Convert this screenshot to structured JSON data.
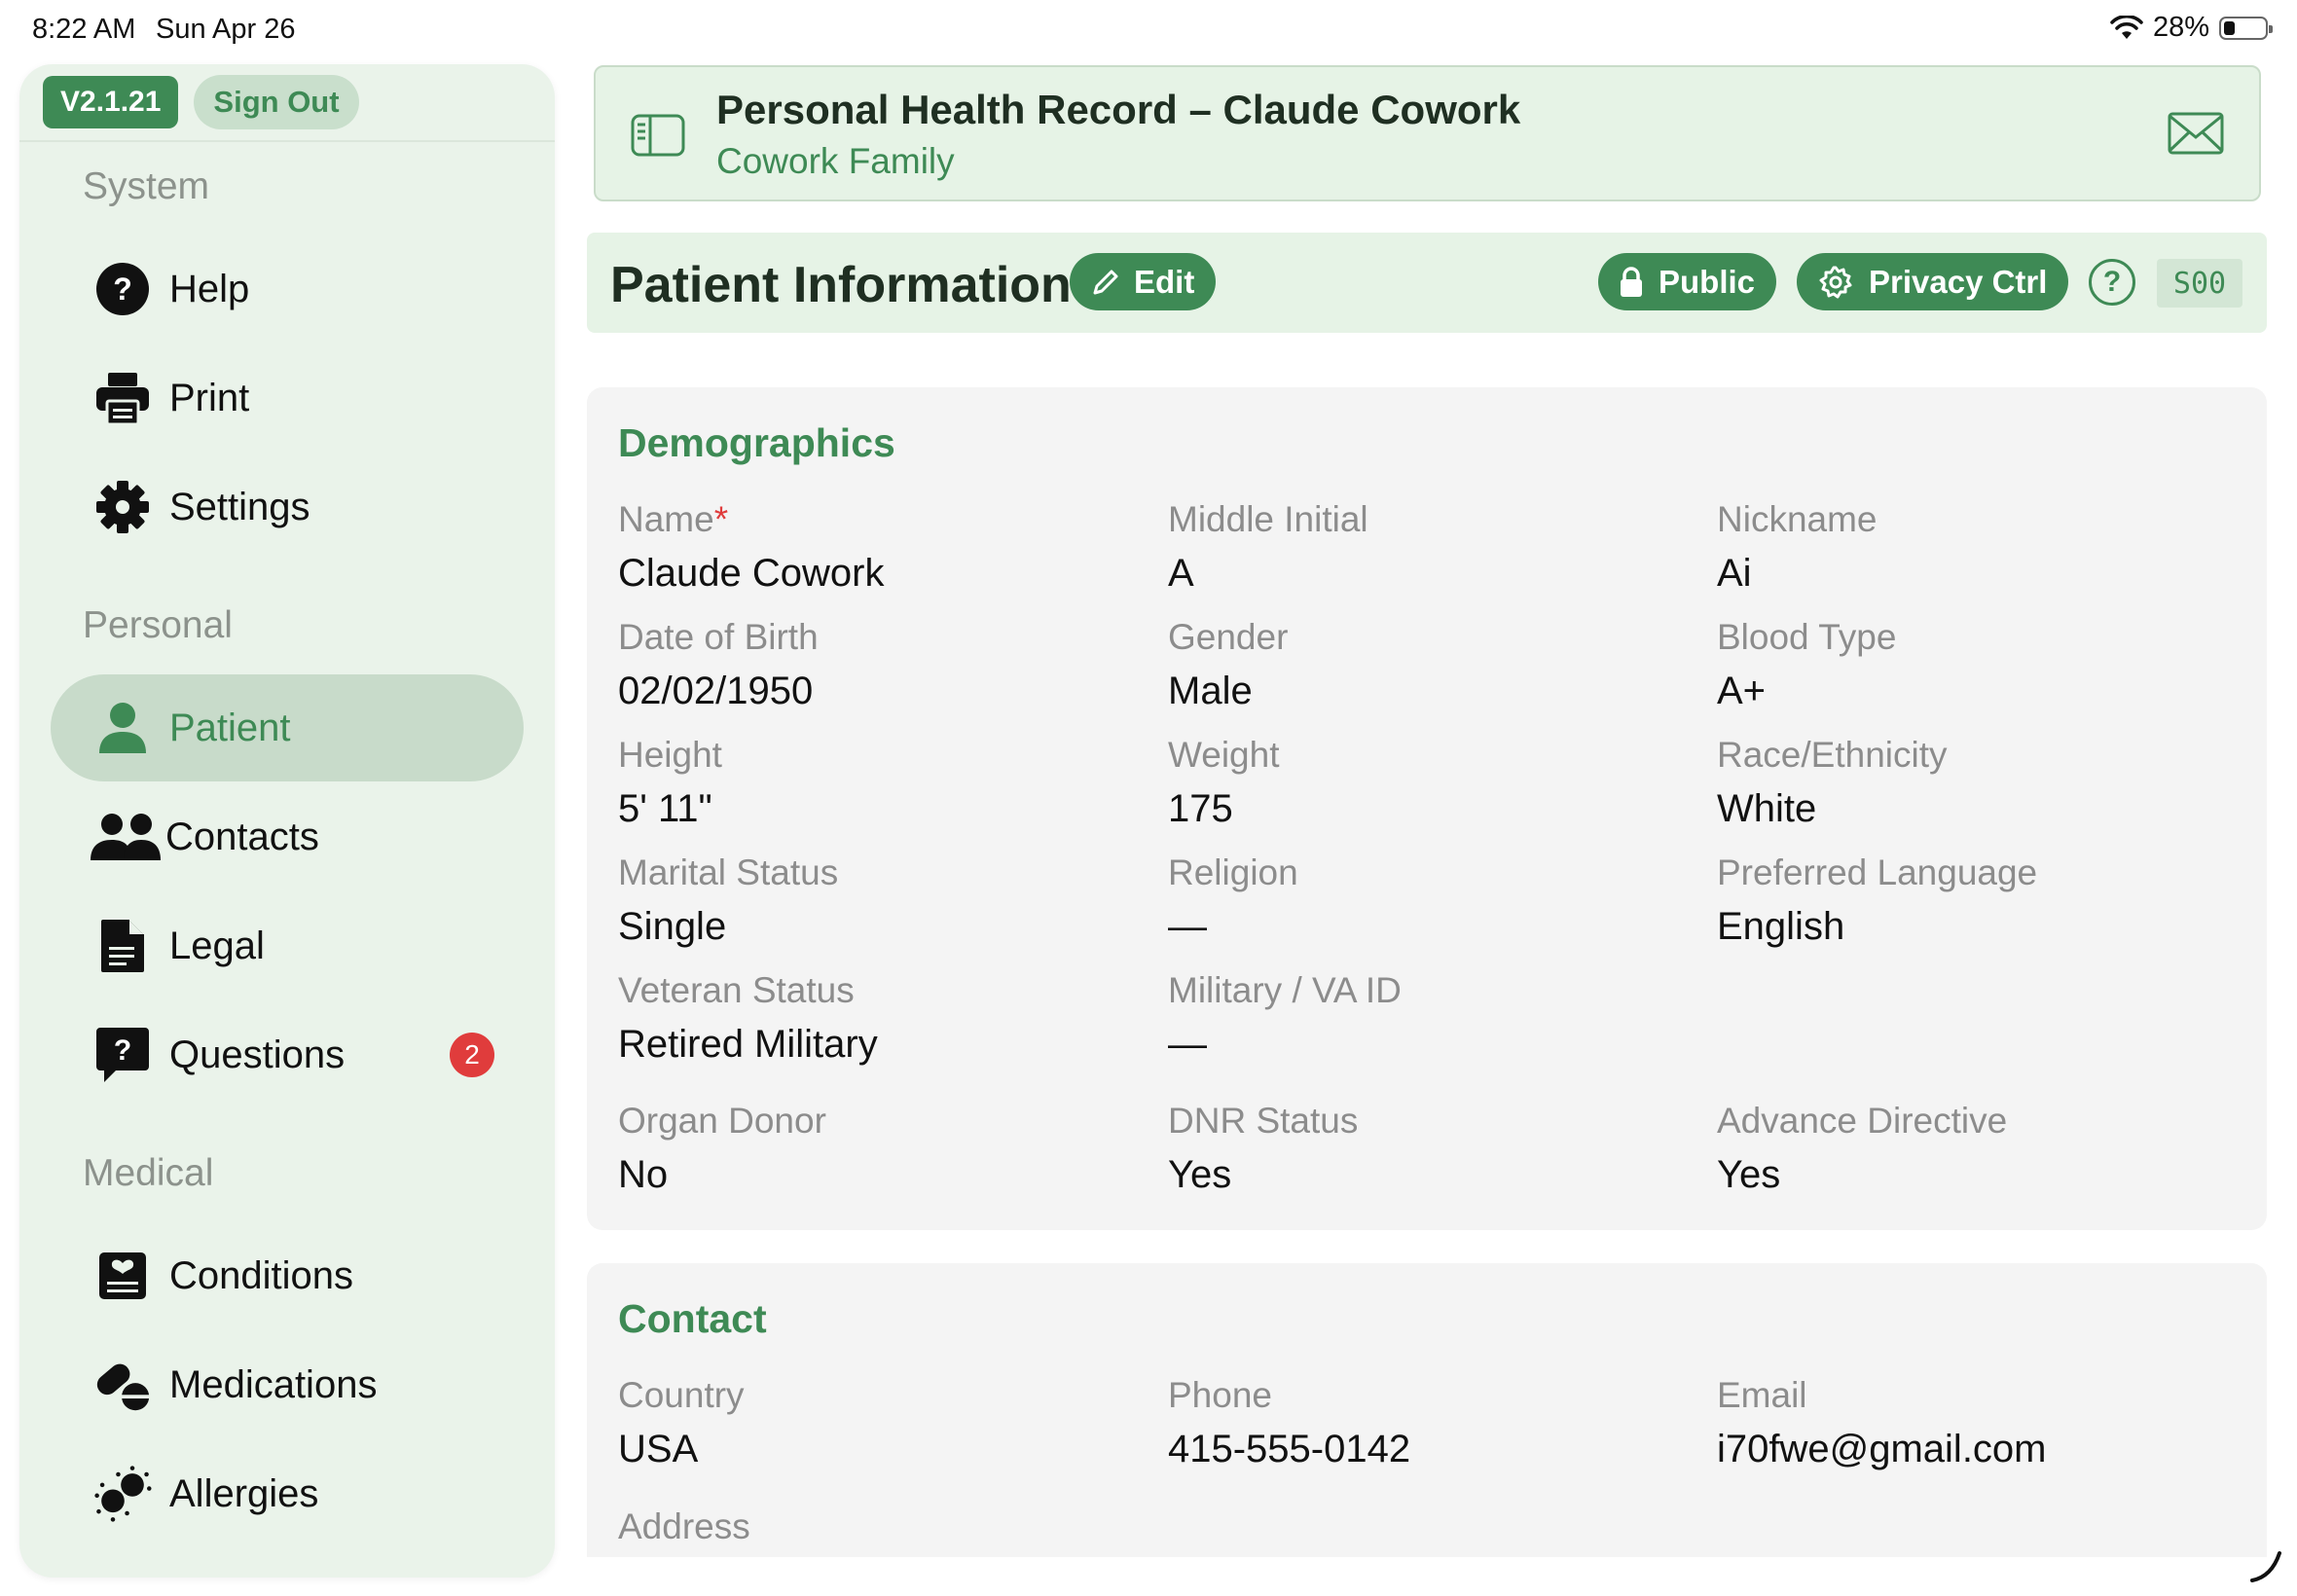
{
  "status_bar": {
    "time": "8:22 AM",
    "date": "Sun Apr 26",
    "battery": "28%",
    "battery_level": 0.28
  },
  "sidebar": {
    "version": "V2.1.21",
    "sign_out": "Sign Out",
    "sections": [
      {
        "label": "System",
        "items": [
          {
            "label": "Help",
            "icon": "help-circle-icon"
          },
          {
            "label": "Print",
            "icon": "printer-icon"
          },
          {
            "label": "Settings",
            "icon": "gear-icon"
          }
        ]
      },
      {
        "label": "Personal",
        "items": [
          {
            "label": "Patient",
            "icon": "person-icon",
            "active": true
          },
          {
            "label": "Contacts",
            "icon": "people-icon"
          },
          {
            "label": "Legal",
            "icon": "document-icon"
          },
          {
            "label": "Questions",
            "icon": "question-bubble-icon",
            "badge": "2"
          }
        ]
      },
      {
        "label": "Medical",
        "items": [
          {
            "label": "Conditions",
            "icon": "heart-clipboard-icon"
          },
          {
            "label": "Medications",
            "icon": "pills-icon"
          },
          {
            "label": "Allergies",
            "icon": "allergen-icon"
          }
        ]
      }
    ]
  },
  "header": {
    "title": "Personal Health Record – Claude Cowork",
    "subtitle": "Cowork Family"
  },
  "page": {
    "title": "Patient Information",
    "edit": "Edit",
    "public": "Public",
    "privacy": "Privacy Ctrl",
    "help": "?",
    "code": "S00"
  },
  "demographics": {
    "title": "Demographics",
    "required_mark": "*",
    "fields": [
      {
        "label": "Name",
        "value": "Claude Cowork",
        "required": true
      },
      {
        "label": "Middle Initial",
        "value": "A"
      },
      {
        "label": "Nickname",
        "value": "Ai"
      },
      {
        "label": "Date of Birth",
        "value": "02/02/1950"
      },
      {
        "label": "Gender",
        "value": "Male"
      },
      {
        "label": "Blood Type",
        "value": "A+"
      },
      {
        "label": "Height",
        "value": "5' 11\""
      },
      {
        "label": "Weight",
        "value": "175"
      },
      {
        "label": "Race/Ethnicity",
        "value": "White"
      },
      {
        "label": "Marital Status",
        "value": "Single"
      },
      {
        "label": "Religion",
        "value": "—"
      },
      {
        "label": "Preferred Language",
        "value": "English"
      },
      {
        "label": "Veteran Status",
        "value": "Retired Military"
      },
      {
        "label": "Military / VA ID",
        "value": "—"
      },
      {
        "label": "Organ Donor",
        "value": "No"
      },
      {
        "label": "DNR Status",
        "value": "Yes"
      },
      {
        "label": "Advance Directive",
        "value": "Yes"
      }
    ]
  },
  "contact": {
    "title": "Contact",
    "fields": [
      {
        "label": "Country",
        "value": "USA"
      },
      {
        "label": "Phone",
        "value": "415-555-0142"
      },
      {
        "label": "Email",
        "value": "i70fwe@gmail.com"
      },
      {
        "label": "Address",
        "value": ""
      }
    ]
  },
  "colors": {
    "accent": "#3e8a55",
    "sidebar_bg": "#eaf3ea",
    "active_bg": "#c8dbca",
    "badge_red": "#e03c3c"
  }
}
